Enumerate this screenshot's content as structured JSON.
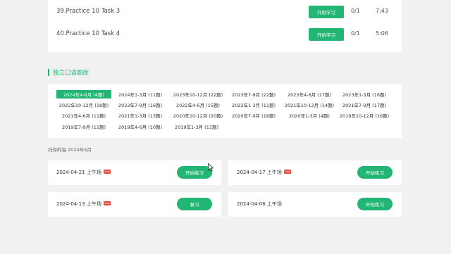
{
  "tasks": [
    {
      "title": "39.Practice 10 Task 3",
      "button": "开始学习",
      "progress": "0/1",
      "time": "7:43"
    },
    {
      "title": "40.Practice 10 Task 4",
      "button": "开始学习",
      "progress": "0/1",
      "time": "5:06"
    }
  ],
  "section": {
    "title": "独立口语题库"
  },
  "years": [
    "2024年4-6月 (4题)",
    "2024年1-3月 (11题)",
    "2023年10-12月 (22题)",
    "2023年7-9月 (22题)",
    "2023年4-6月 (17题)",
    "2023年1-3月 (16题)",
    "2022年10-12月 (18题)",
    "2022年7-9月 (16题)",
    "2022年4-6月 (15题)",
    "2022年1-3月 (11题)",
    "2021年10-12月 (14题)",
    "2021年7-9月 (17题)",
    "2021年4-6月 (11题)",
    "2021年1-3月 (13题)",
    "2020年10-12月 (20题)",
    "2020年7-9月 (18题)",
    "2020年1-3月 (4题)",
    "2019年10-12月 (16题)",
    "2019年7-9月 (11题)",
    "2019年4-6月 (10题)",
    "2019年1-3月 (11题)"
  ],
  "predict_label": "托你的福 2024年4月",
  "sessions": [
    {
      "date": "2024-04-21 上午场",
      "badge": "new",
      "button": "开始练习"
    },
    {
      "date": "2024-04-17 上午场",
      "badge": "new",
      "button": "开始练习"
    },
    {
      "date": "2024-04-13 上午场",
      "badge": "new",
      "button": "复习"
    },
    {
      "date": "2024-04-06 上午场",
      "badge": "",
      "button": "开始练习"
    }
  ],
  "colors": {
    "accent": "#22b573",
    "badge": "#e84a3c",
    "background": "#f0f1f0"
  }
}
